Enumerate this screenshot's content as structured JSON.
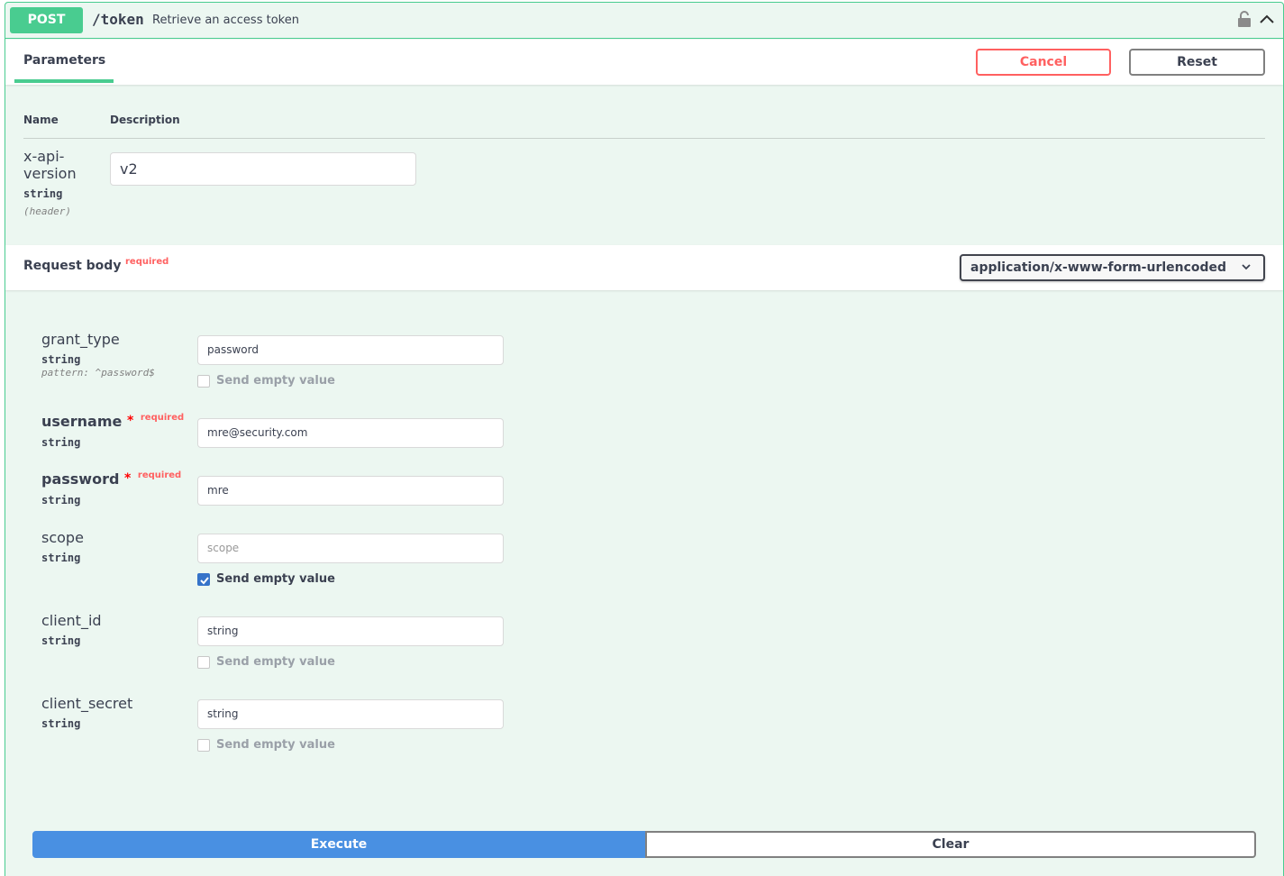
{
  "summary": {
    "method": "POST",
    "path": "/token",
    "description": "Retrieve an access token",
    "lock_icon": "unlocked-padlock-icon",
    "toggle_icon": "chevron-up-icon"
  },
  "tabs": {
    "parameters_label": "Parameters",
    "cancel_label": "Cancel",
    "reset_label": "Reset"
  },
  "parameters": {
    "col_name": "Name",
    "col_description": "Description",
    "items": [
      {
        "name": "x-api-version",
        "type": "string",
        "in": "(header)",
        "value": "v2"
      }
    ]
  },
  "request_body": {
    "title": "Request body",
    "required_label": "required",
    "content_type": "application/x-www-form-urlencoded",
    "fields": [
      {
        "name": "grant_type",
        "type": "string",
        "pattern": "pattern: ^password$",
        "value": "password",
        "send_empty_label": "Send empty value",
        "send_empty_checked": false
      },
      {
        "name": "username",
        "required_star": "*",
        "required_label": "required",
        "type": "string",
        "value": "mre@security.com"
      },
      {
        "name": "password",
        "required_star": "*",
        "required_label": "required",
        "type": "string",
        "value": "mre"
      },
      {
        "name": "scope",
        "type": "string",
        "placeholder": "scope",
        "value": "",
        "send_empty_label": "Send empty value",
        "send_empty_checked": true
      },
      {
        "name": "client_id",
        "type": "string",
        "value": "string",
        "send_empty_label": "Send empty value",
        "send_empty_checked": false
      },
      {
        "name": "client_secret",
        "type": "string",
        "value": "string",
        "send_empty_label": "Send empty value",
        "send_empty_checked": false
      }
    ]
  },
  "actions": {
    "execute_label": "Execute",
    "clear_label": "Clear"
  },
  "colors": {
    "post_green": "#49cc90",
    "panel_bg": "#ecf7f1",
    "cancel_red": "#ff6060",
    "execute_blue": "#4990e2",
    "checkbox_blue": "#3573c9"
  }
}
